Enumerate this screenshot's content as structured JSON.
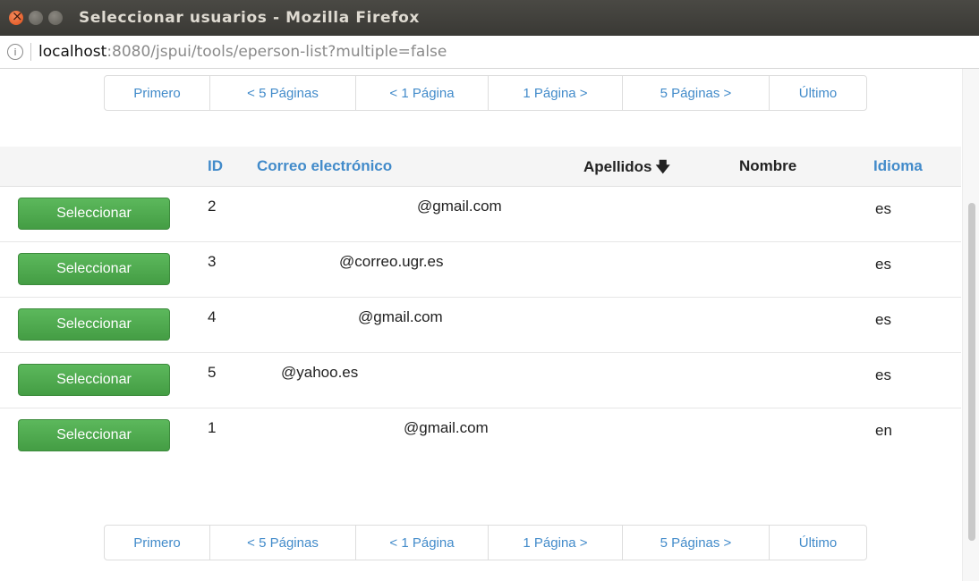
{
  "window": {
    "title": "Seleccionar usuarios - Mozilla Firefox"
  },
  "urlbar": {
    "host": "localhost",
    "rest": ":8080/jspui/tools/eperson-list?multiple=false"
  },
  "pagination": [
    "Primero",
    "< 5 Páginas",
    "< 1 Página",
    "1 Página >",
    "5 Páginas >",
    "Último"
  ],
  "table": {
    "headers": {
      "id": "ID",
      "email": "Correo electrónico",
      "lastname": "Apellidos",
      "sort_arrow": "🡇",
      "firstname": "Nombre",
      "lang": "Idioma"
    },
    "select_label": "Seleccionar",
    "rows": [
      {
        "id": "2",
        "email": "@gmail.com",
        "lang": "es"
      },
      {
        "id": "3",
        "email": "@correo.ugr.es",
        "lang": "es"
      },
      {
        "id": "4",
        "email": "@gmail.com",
        "lang": "es"
      },
      {
        "id": "5",
        "email": "@yahoo.es",
        "lang": "es"
      },
      {
        "id": "1",
        "email": "@gmail.com",
        "lang": "en"
      }
    ]
  }
}
